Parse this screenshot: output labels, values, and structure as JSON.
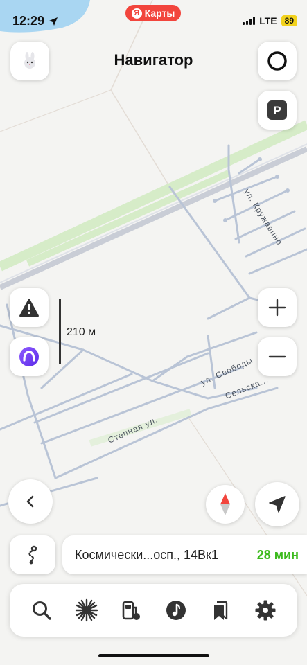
{
  "status_bar": {
    "time": "12:29",
    "network": "LTE",
    "battery": "89"
  },
  "app_pill": {
    "logo": "Я",
    "label": "Карты"
  },
  "header": {
    "title": "Навигатор"
  },
  "map": {
    "scale": "210 м",
    "streets": [
      "ул. Кружавино",
      "ул. Свободы",
      "Сельска...",
      "Степная ул."
    ]
  },
  "route": {
    "destination": "Космически...осп., 14Вк1",
    "eta": "28 мин"
  },
  "toolbar": {
    "icons": [
      "search-icon",
      "sun-icon",
      "fuel-station-icon",
      "music-icon",
      "bookmark-icon",
      "settings-icon"
    ]
  },
  "colors": {
    "accent_red": "#f2453d",
    "eta_green": "#3dba1e",
    "alice_purple": "#7a3cff"
  }
}
